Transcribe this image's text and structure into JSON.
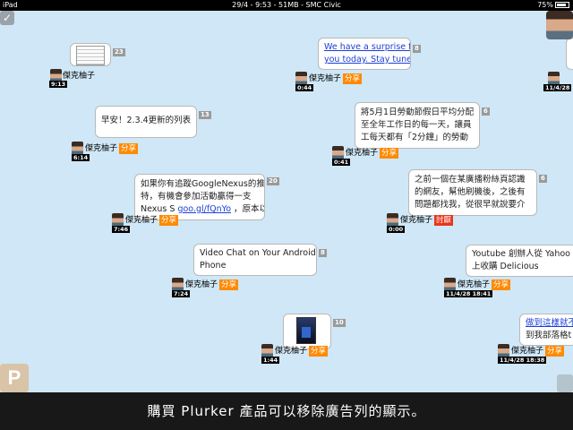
{
  "status_bar": {
    "carrier": "iPad",
    "center": "29/4 - 9:53 - 51MB - SMC Civic",
    "battery": "75%"
  },
  "user": {
    "name": "傑克柚子"
  },
  "plurks": [
    {
      "id": "p1",
      "timestamp": "9:13",
      "qualifier": "",
      "count": "23",
      "text": "",
      "link": ""
    },
    {
      "id": "p2",
      "timestamp": "6:14",
      "qualifier": "分享",
      "count": "13",
      "text": "早安！2.3.4更新的列表",
      "link": ""
    },
    {
      "id": "p3",
      "timestamp": "7:46",
      "qualifier": "分享",
      "count": "20",
      "text_line1": "如果你有追蹤GoogleNexus的推",
      "text_line2": "特，有機會參加活動贏得一支",
      "text_line3_pre": "Nexus S ",
      "link": "goo.gl/fQnYo",
      "text_line3_post": " ，原本以"
    },
    {
      "id": "p4",
      "timestamp": "7:24",
      "qualifier": "分享",
      "count": "8",
      "text_line1": "Video Chat on Your Android",
      "text_line2": "Phone"
    },
    {
      "id": "p5",
      "timestamp": "1:44",
      "qualifier": "分享",
      "count": "10",
      "text": ""
    },
    {
      "id": "p6",
      "timestamp": "0:44",
      "qualifier": "分享",
      "count": "8",
      "link_line1": "We have a surprise for",
      "link_line2": "you today. Stay tuned!"
    },
    {
      "id": "p7",
      "timestamp": "0:41",
      "qualifier": "分享",
      "count": "6",
      "text_line1": "將5月1日勞動節假日平均分配",
      "text_line2": "至全年工作日的每一天，讓員",
      "text_line3": "工每天都有「2分鐘」的勞動"
    },
    {
      "id": "p8",
      "timestamp": "0:00",
      "qualifier": "討厭",
      "count": "6",
      "text_line1": "之前一個在某廣播粉絲頁認識",
      "text_line2": "的網友，幫他刷機後，之後有",
      "text_line3": "問題都找我，從很早就說要介"
    },
    {
      "id": "p9",
      "timestamp": "11/4/28 18:41",
      "qualifier": "分享",
      "count": "",
      "text_line1": "Youtube 創辦人從 Yahoo",
      "text_line2": "上收購 Delicious"
    },
    {
      "id": "p10",
      "timestamp": "11/4/28 18:38",
      "qualifier": "分享",
      "count": "",
      "link_line1": "做到這樣就不",
      "text_line2": "到我部落格t"
    },
    {
      "id": "p11",
      "timestamp": "11/4/28",
      "qualifier": "",
      "count": "",
      "text": ""
    }
  ],
  "ad_bar": {
    "text": "購買 Plurker 產品可以移除廣告列的顯示。"
  },
  "buttons": {
    "p_label": "P",
    "check_label": "✓"
  }
}
